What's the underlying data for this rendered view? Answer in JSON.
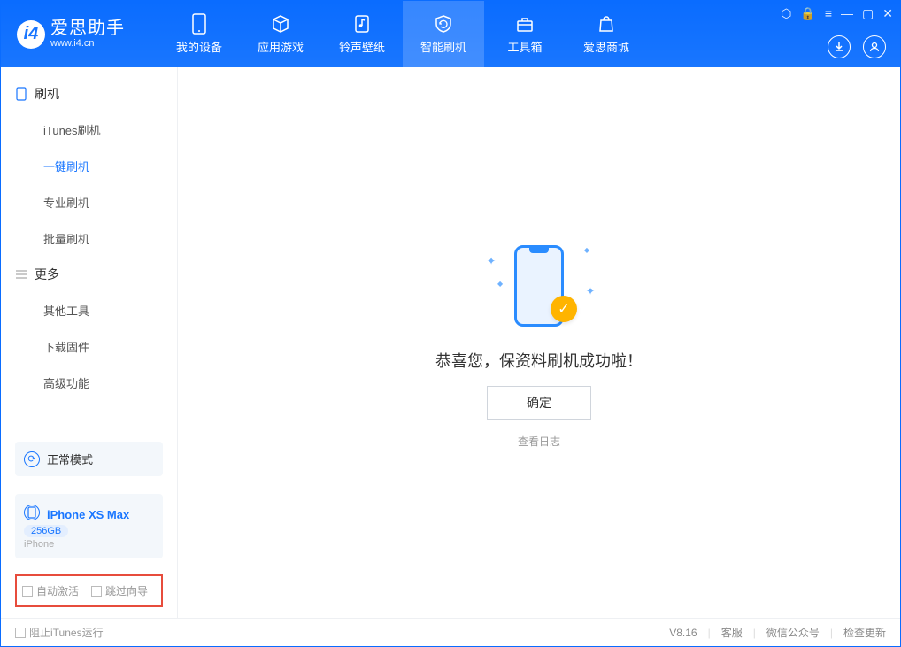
{
  "app": {
    "title": "爱思助手",
    "subtitle": "www.i4.cn"
  },
  "tabs": [
    {
      "label": "我的设备"
    },
    {
      "label": "应用游戏"
    },
    {
      "label": "铃声壁纸"
    },
    {
      "label": "智能刷机"
    },
    {
      "label": "工具箱"
    },
    {
      "label": "爱思商城"
    }
  ],
  "sidebar": {
    "section1_title": "刷机",
    "section1_items": [
      "iTunes刷机",
      "一键刷机",
      "专业刷机",
      "批量刷机"
    ],
    "section2_title": "更多",
    "section2_items": [
      "其他工具",
      "下载固件",
      "高级功能"
    ]
  },
  "device": {
    "mode_label": "正常模式",
    "name": "iPhone XS Max",
    "storage": "256GB",
    "type": "iPhone"
  },
  "options": {
    "auto_activate": "自动激活",
    "skip_guide": "跳过向导"
  },
  "main": {
    "success_text": "恭喜您，保资料刷机成功啦！",
    "confirm_label": "确定",
    "log_label": "查看日志"
  },
  "footer": {
    "stop_itunes": "阻止iTunes运行",
    "version": "V8.16",
    "links": [
      "客服",
      "微信公众号",
      "检查更新"
    ]
  }
}
